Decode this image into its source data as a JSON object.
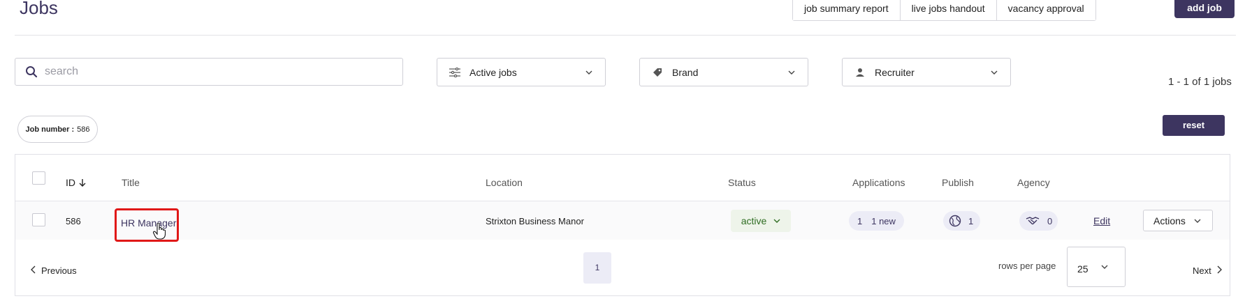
{
  "header": {
    "title": "Jobs",
    "buttons": [
      "job summary report",
      "live jobs handout",
      "vacancy approval"
    ],
    "add_job": "add job"
  },
  "filters": {
    "search_placeholder": "search",
    "status_filter": "Active jobs",
    "brand_filter": "Brand",
    "recruiter_filter": "Recruiter",
    "result_count": "1 - 1 of 1 jobs",
    "chip_label": "Job number :",
    "chip_value": "586",
    "reset": "reset"
  },
  "table": {
    "columns": {
      "id": "ID",
      "title": "Title",
      "location": "Location",
      "status": "Status",
      "applications": "Applications",
      "publish": "Publish",
      "agency": "Agency"
    },
    "rows": [
      {
        "id": "586",
        "title": "HR Manager",
        "location": "Strixton Business Manor",
        "status": "active",
        "applications": "1",
        "applications_new": "1 new",
        "publish_count": "1",
        "agency_count": "0",
        "edit": "Edit",
        "actions": "Actions"
      }
    ]
  },
  "pagination": {
    "previous": "Previous",
    "current_page": "1",
    "rows_per_page_label": "rows per page",
    "rows_per_page": "25",
    "next": "Next"
  },
  "colors": {
    "brand": "#3d3560",
    "highlight": "#e01818",
    "status_active": "#2f6d22"
  }
}
